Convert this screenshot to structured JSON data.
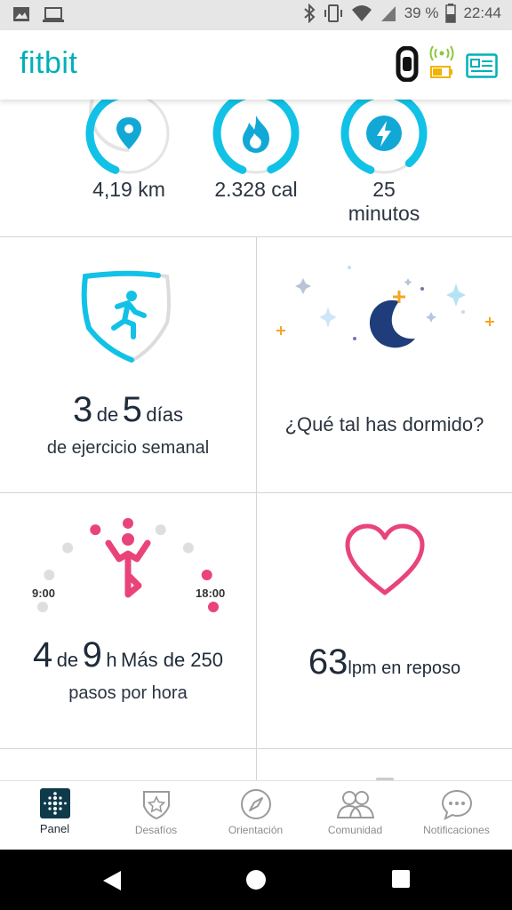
{
  "status_bar": {
    "battery_percent": "39 %",
    "time": "22:44",
    "icons": [
      "image-icon",
      "laptop-icon",
      "bluetooth-icon",
      "vibrate-icon",
      "wifi-icon",
      "cell-signal-icon",
      "battery-icon"
    ]
  },
  "header": {
    "logo": "fitbit",
    "icons": [
      "tracker-device-icon",
      "sync-signal-icon",
      "low-battery-icon",
      "profile-card-icon"
    ],
    "colors": {
      "brand": "#00b0b9",
      "battery": "#f0b400",
      "signal": "#8cc63f"
    }
  },
  "stats": [
    {
      "icon": "location-pin-icon",
      "value": "4,19 km",
      "unit": "",
      "progress": 0.42
    },
    {
      "icon": "flame-icon",
      "value": "2.328 cal",
      "unit": "",
      "progress": 0.9
    },
    {
      "icon": "lightning-icon",
      "value": "25",
      "unit": "minutos",
      "progress": 0.85
    }
  ],
  "tiles": {
    "exercise": {
      "count": "3",
      "of": "de",
      "goal": "5",
      "unit": "días",
      "caption": "de ejercicio semanal",
      "icon": "running-person-shield-icon",
      "progress": 0.6
    },
    "sleep": {
      "prompt": "¿Qué tal has dormido?",
      "icon": "moon-stars-icon"
    },
    "hourly": {
      "count": "4",
      "of": "de",
      "goal": "9",
      "unit": "h",
      "caption_a": "Más de 250",
      "caption_b": "pasos por hora",
      "start_label": "9:00",
      "end_label": "18:00",
      "icon": "stretching-person-icon",
      "hours_met": [
        false,
        false,
        false,
        true,
        true,
        false,
        false,
        true,
        true
      ]
    },
    "heart": {
      "value": "63",
      "unit": "lpm en reposo",
      "icon": "heart-icon"
    }
  },
  "nav": [
    {
      "label": "Panel",
      "icon": "dashboard-icon",
      "active": true
    },
    {
      "label": "Desafíos",
      "icon": "challenges-star-icon",
      "active": false
    },
    {
      "label": "Orientación",
      "icon": "compass-icon",
      "active": false
    },
    {
      "label": "Comunidad",
      "icon": "community-people-icon",
      "active": false
    },
    {
      "label": "Notificaciones",
      "icon": "chat-bubble-icon",
      "active": false
    }
  ],
  "system_nav": [
    "back-icon",
    "home-icon",
    "recents-icon"
  ],
  "colors": {
    "ring": "#12c2e6",
    "ring_track": "#e4e4e4",
    "heart": "#e9447a",
    "moon": "#1f3d7a",
    "star_orange": "#f5a623"
  }
}
